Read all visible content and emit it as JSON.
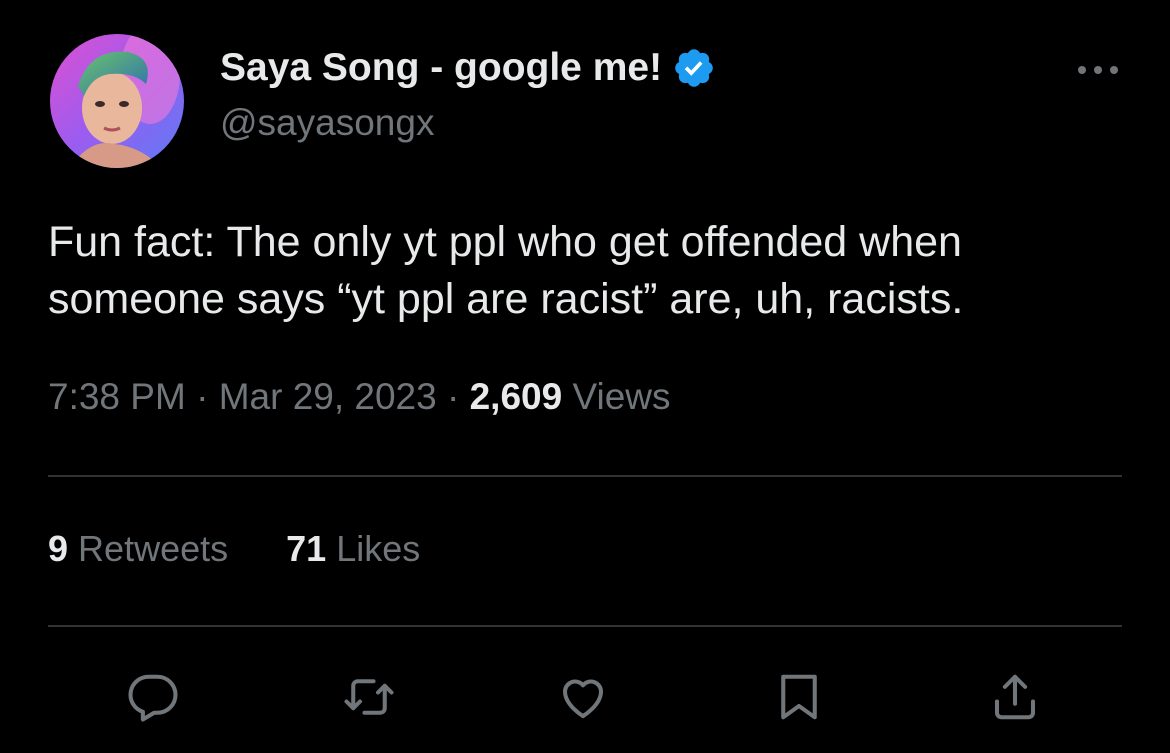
{
  "author": {
    "display_name": "Saya Song - google me!",
    "handle": "@sayasongx",
    "verified": true
  },
  "tweet": {
    "text_lines": [
      "Fun fact: The only yt ppl who get offended when",
      "someone says “yt ppl are racist” are, uh, racists."
    ],
    "time": "7:38 PM",
    "separator": "·",
    "date": "Mar 29, 2023",
    "views_count": "2,609",
    "views_label": "Views"
  },
  "stats": {
    "retweets_count": "9",
    "retweets_label": "Retweets",
    "likes_count": "71",
    "likes_label": "Likes"
  },
  "icons": {
    "more": "more-horizontal-icon",
    "verified": "verified-badge-icon",
    "reply": "reply-icon",
    "retweet": "retweet-icon",
    "like": "heart-icon",
    "bookmark": "bookmark-icon",
    "share": "share-icon"
  },
  "colors": {
    "background": "#000000",
    "primary_text": "#e7e9ea",
    "secondary_text": "#71767b",
    "divider": "#2f3336",
    "verified_blue": "#1d9bf0"
  }
}
